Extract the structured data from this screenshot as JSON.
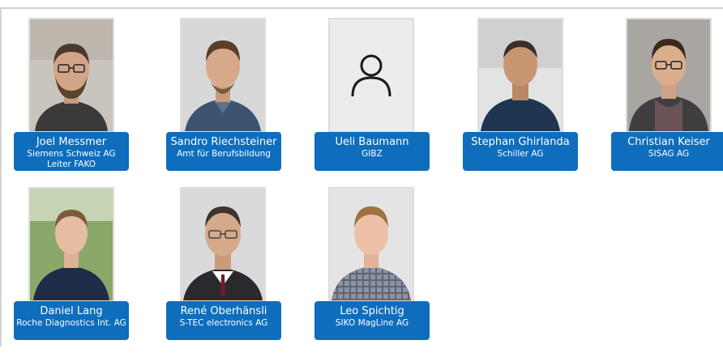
{
  "people": [
    {
      "name": "Joel Messmer",
      "company": "Siemens Schweiz AG",
      "role": "Leiter FAKO",
      "avatar": "photo-portrait"
    },
    {
      "name": "Sandro Riechsteiner",
      "company": "Amt für Berufsbildung",
      "avatar": "photo-portrait"
    },
    {
      "name": "Ueli Baumann",
      "company": "GIBZ",
      "avatar": "user-placeholder-icon"
    },
    {
      "name": "Stephan Ghirlanda",
      "company": "Schiller AG",
      "avatar": "photo-portrait"
    },
    {
      "name": "Christian Keiser",
      "company": "SISAG AG",
      "avatar": "photo-portrait"
    },
    {
      "name": "Daniel Lang",
      "company": "Roche Diagnostics Int. AG",
      "avatar": "photo-portrait"
    },
    {
      "name": "René Oberhänsli",
      "company": "S-TEC electronics AG",
      "avatar": "photo-portrait"
    },
    {
      "name": "Leo Spichtig",
      "company": "SIKO MagLine AG",
      "avatar": "photo-portrait"
    }
  ],
  "colors": {
    "label_bg": "#0e6dbd",
    "label_text": "#ffffff",
    "photo_border": "#dcdcdc"
  }
}
